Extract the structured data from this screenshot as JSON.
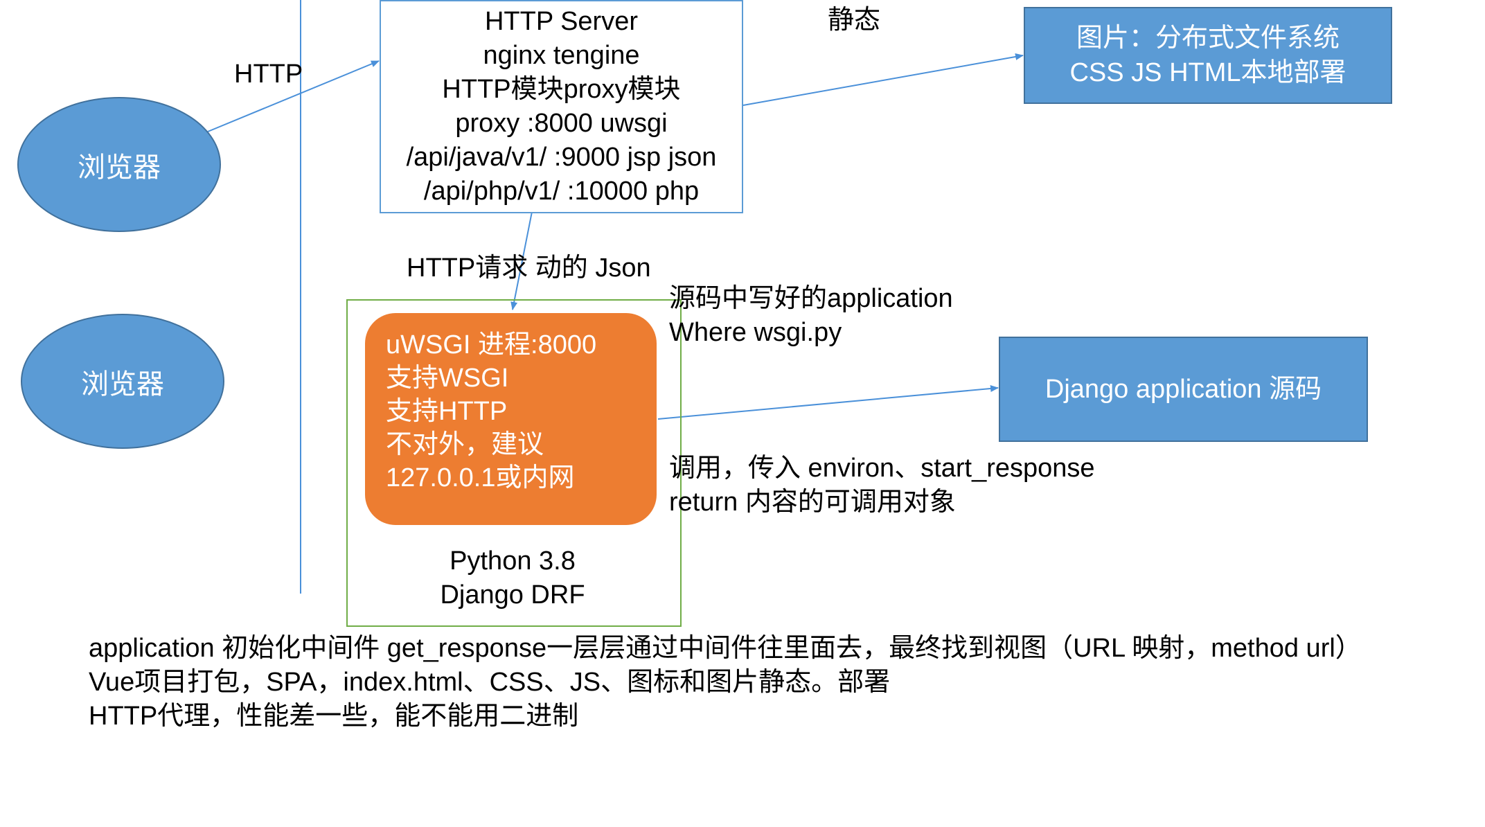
{
  "nodes": {
    "browser_top": "浏览器",
    "browser_bottom": "浏览器",
    "http_server": [
      "HTTP Server",
      "nginx tengine",
      "HTTP模块proxy模块",
      "proxy :8000 uwsgi",
      "/api/java/v1/ :9000 jsp json",
      "/api/php/v1/ :10000 php"
    ],
    "static_storage": [
      "图片：分布式文件系统",
      "CSS JS HTML本地部署"
    ],
    "uwsgi": [
      "uWSGI 进程:8000",
      "支持WSGI",
      "支持HTTP",
      "不对外，建议",
      "127.0.0.1或内网"
    ],
    "django_app": "Django application 源码"
  },
  "labels": {
    "http": "HTTP",
    "static": "静态",
    "http_request": "HTTP请求 动的 Json",
    "app_source": [
      "源码中写好的application",
      "Where wsgi.py"
    ],
    "invoke": [
      "调用，传入 environ、start_response",
      "return 内容的可调用对象"
    ],
    "python_stack": [
      "Python 3.8",
      "Django DRF"
    ]
  },
  "notes": [
    "application 初始化中间件 get_response一层层通过中间件往里面去，最终找到视图（URL 映射，method url）",
    "Vue项目打包，SPA，index.html、CSS、JS、图标和图片静态。部署",
    "HTTP代理，性能差一些，能不能用二进制"
  ],
  "colors": {
    "blue_fill": "#5b9bd5",
    "blue_border": "#41719c",
    "orange_fill": "#ed7d31",
    "green_frame": "#70ad47",
    "text": "#000000"
  }
}
